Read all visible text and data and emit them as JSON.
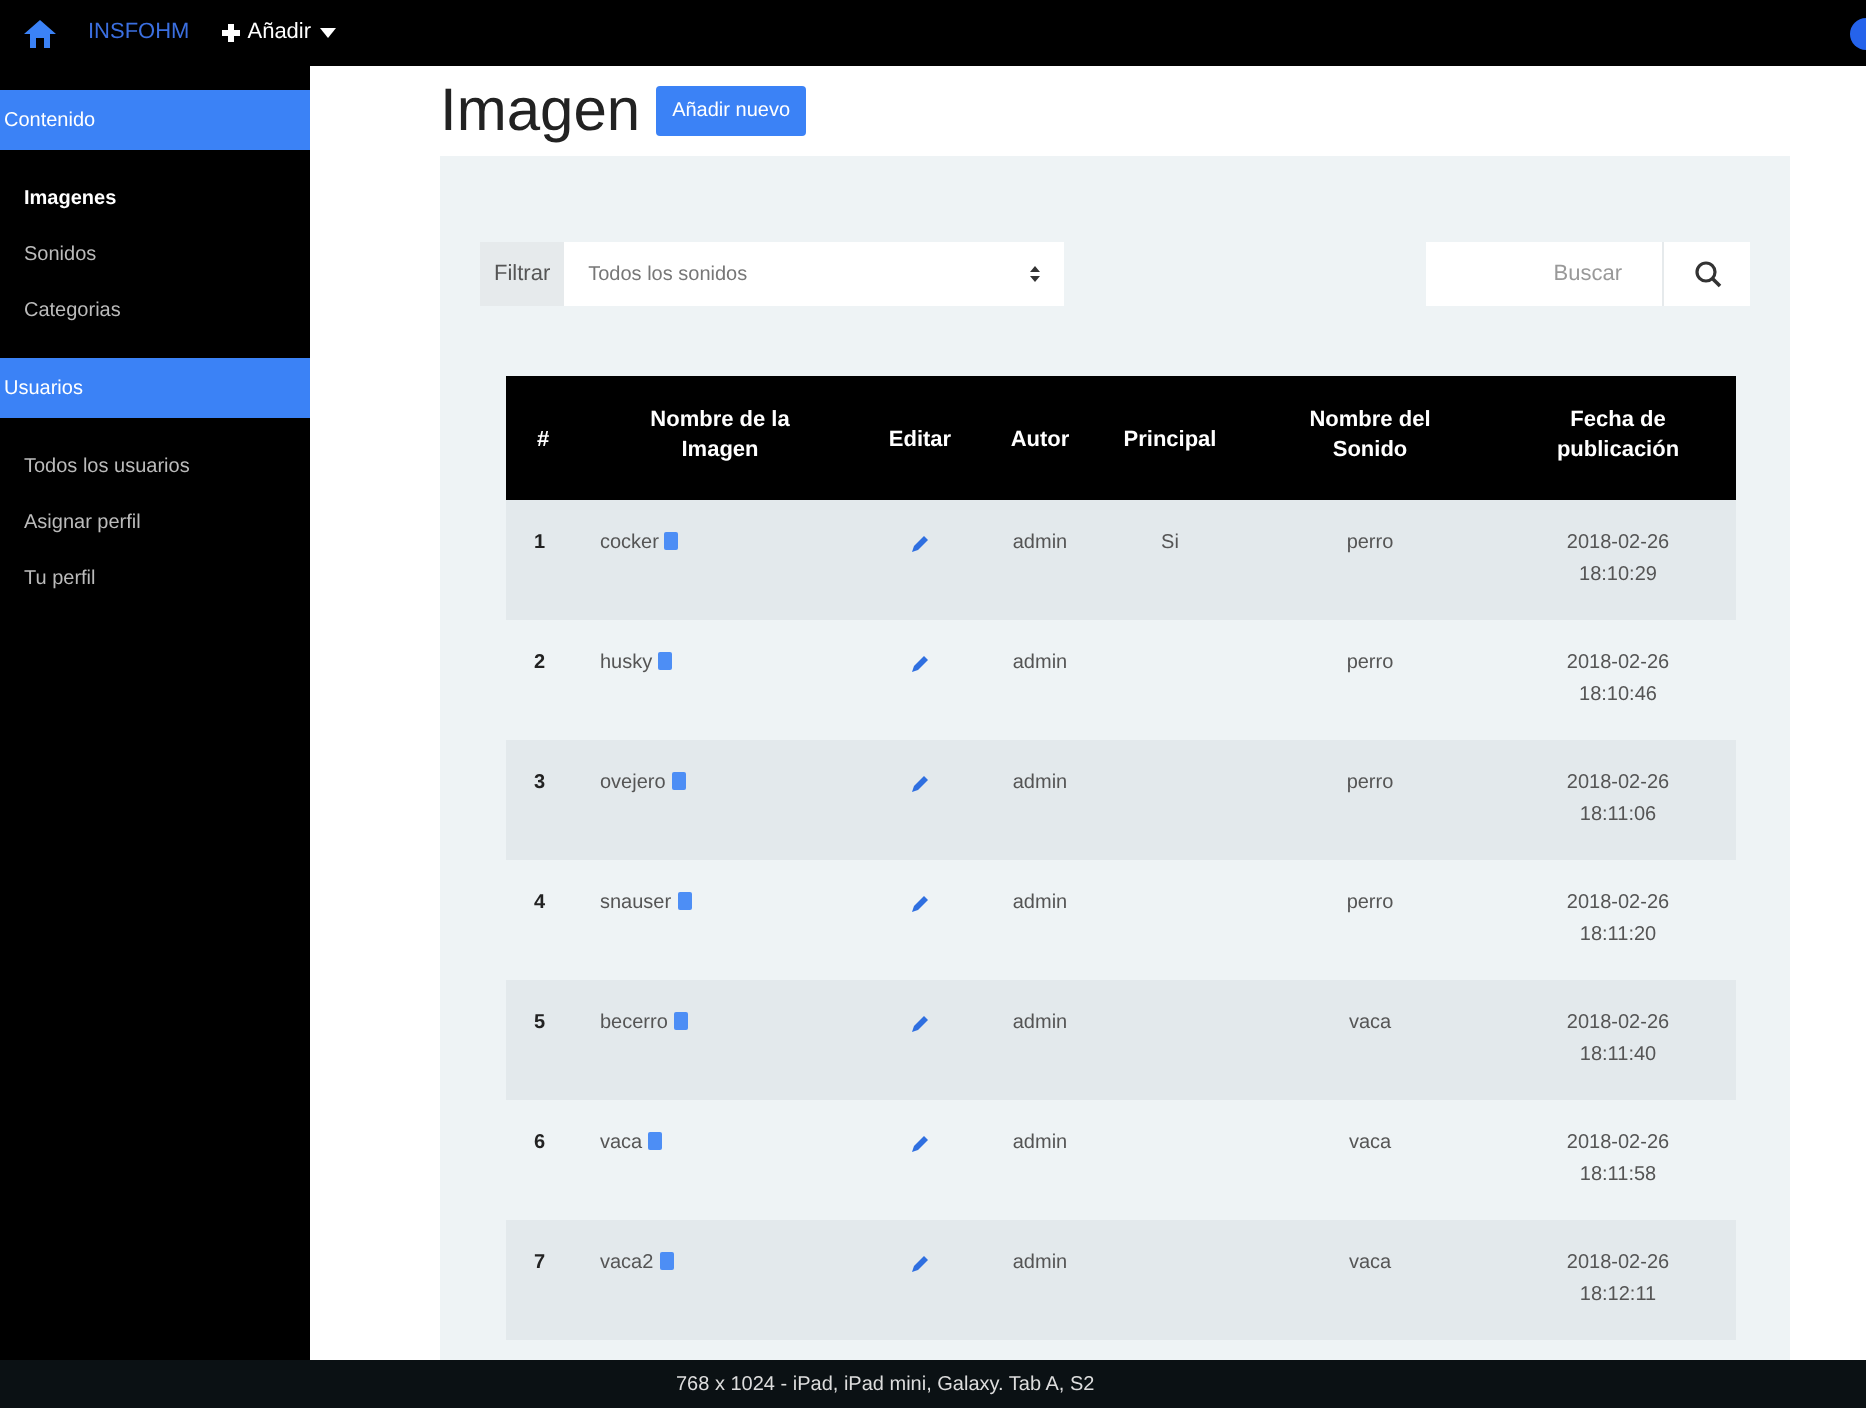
{
  "navbar": {
    "brand": "INSFOHM",
    "add_menu": "Añadir"
  },
  "sidebar": {
    "sections": [
      {
        "title": "Contenido",
        "items": [
          {
            "label": "Imagenes",
            "selected": true
          },
          {
            "label": "Sonidos",
            "selected": false
          },
          {
            "label": "Categorias",
            "selected": false
          }
        ]
      },
      {
        "title": "Usuarios",
        "items": [
          {
            "label": "Todos los usuarios",
            "selected": false
          },
          {
            "label": "Asignar perfil",
            "selected": false
          },
          {
            "label": "Tu perfil",
            "selected": false
          }
        ]
      }
    ]
  },
  "page": {
    "title": "Imagen",
    "add_button": "Añadir nuevo"
  },
  "filter": {
    "label": "Filtrar",
    "value": "Todos los sonidos"
  },
  "search": {
    "placeholder": "Buscar"
  },
  "table": {
    "columns": [
      "#",
      "Nombre de la Imagen",
      "Editar",
      "Autor",
      "Principal",
      "Nombre del Sonido",
      "Fecha de publicación"
    ],
    "rows": [
      {
        "number": "1",
        "name": "cocker",
        "author": "admin",
        "main": "Si",
        "sound": "perro",
        "date": "2018-02-26 18:10:29"
      },
      {
        "number": "2",
        "name": "husky",
        "author": "admin",
        "sound": "perro",
        "date": "2018-02-26 18:10:46"
      },
      {
        "number": "3",
        "name": "ovejero",
        "author": "admin",
        "sound": "perro",
        "date": "2018-02-26 18:11:06"
      },
      {
        "number": "4",
        "name": "snauser",
        "author": "admin",
        "sound": "perro",
        "date": "2018-02-26 18:11:20"
      },
      {
        "number": "5",
        "name": "becerro",
        "author": "admin",
        "sound": "vaca",
        "date": "2018-02-26 18:11:40"
      },
      {
        "number": "6",
        "name": "vaca",
        "author": "admin",
        "sound": "vaca",
        "date": "2018-02-26 18:11:58"
      },
      {
        "number": "7",
        "name": "vaca2",
        "author": "admin",
        "sound": "vaca",
        "date": "2018-02-26 18:12:11"
      }
    ]
  },
  "device_bar": "768 x 1024 - iPad, iPad mini, Galaxy. Tab A, S2"
}
